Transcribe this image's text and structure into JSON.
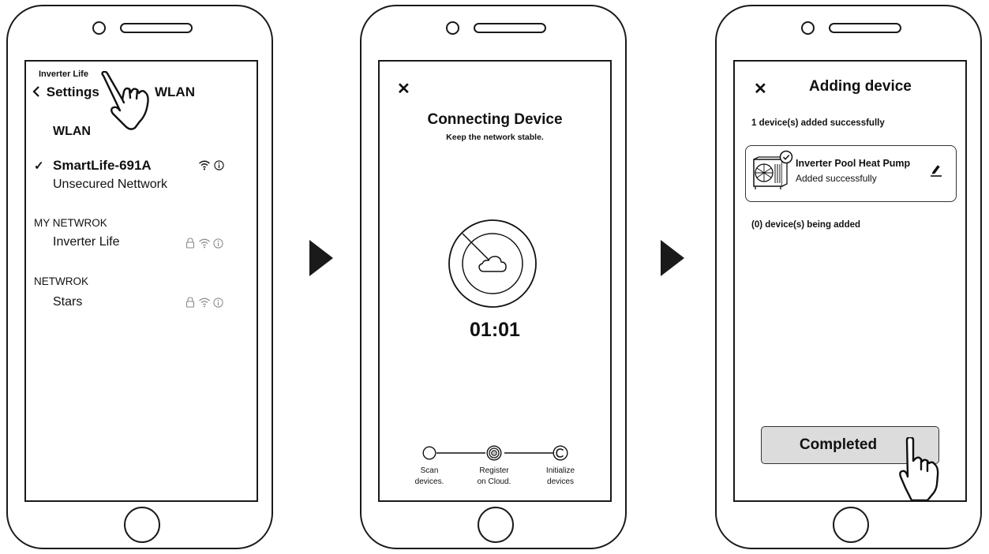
{
  "screen1": {
    "hint": "Inverter Life",
    "back_label": "Settings",
    "header_title": "WLAN",
    "section_title": "WLAN",
    "connected": {
      "name": "SmartLife-691A",
      "status": "Unsecured Nettwork"
    },
    "groups": [
      {
        "title": "MY NETWROK",
        "network": "Inverter Life"
      },
      {
        "title": "NETWROK",
        "network": "Stars"
      }
    ]
  },
  "screen2": {
    "title": "Connecting Device",
    "subtitle": "Keep the network stable.",
    "timer": "01:01",
    "steps": [
      {
        "line1": "Scan",
        "line2": "devices."
      },
      {
        "line1": "Register",
        "line2": "on Cloud."
      },
      {
        "line1": "Initialize",
        "line2": "devices"
      }
    ]
  },
  "screen3": {
    "title": "Adding device",
    "added_msg": "1 device(s) added successfully",
    "device": {
      "name": "Inverter Pool Heat Pump",
      "status": "Added successfully"
    },
    "pending_msg": "(0) device(s) being added",
    "button_label": "Completed"
  }
}
